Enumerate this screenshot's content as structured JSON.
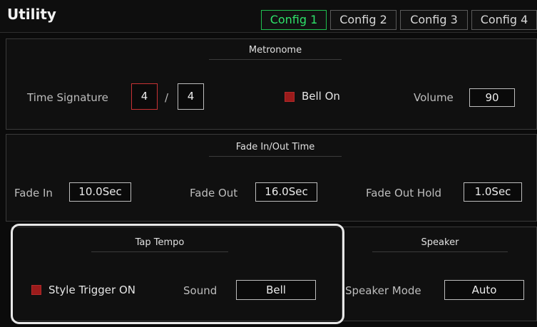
{
  "header": {
    "title": "Utility",
    "tabs": [
      {
        "label": "Config 1",
        "active": true
      },
      {
        "label": "Config 2",
        "active": false
      },
      {
        "label": "Config 3",
        "active": false
      },
      {
        "label": "Config 4",
        "active": false
      }
    ]
  },
  "metronome": {
    "title": "Metronome",
    "time_signature_label": "Time Signature",
    "numerator": "4",
    "separator": "/",
    "denominator": "4",
    "bell_label": "Bell On",
    "bell_checked": true,
    "volume_label": "Volume",
    "volume_value": "90"
  },
  "fade": {
    "title": "Fade In/Out Time",
    "fade_in_label": "Fade In",
    "fade_in_value": "10.0Sec",
    "fade_out_label": "Fade Out",
    "fade_out_value": "16.0Sec",
    "fade_out_hold_label": "Fade Out Hold",
    "fade_out_hold_value": "1.0Sec"
  },
  "tap_tempo": {
    "title": "Tap Tempo",
    "style_trigger_label": "Style Trigger ON",
    "style_trigger_checked": true,
    "sound_label": "Sound",
    "sound_value": "Bell"
  },
  "speaker": {
    "title": "Speaker",
    "mode_label": "Speaker Mode",
    "mode_value": "Auto"
  },
  "colors": {
    "active_tab": "#2ee36a",
    "checkbox": "#9b1b1b",
    "selected_field_border": "#c73234"
  }
}
